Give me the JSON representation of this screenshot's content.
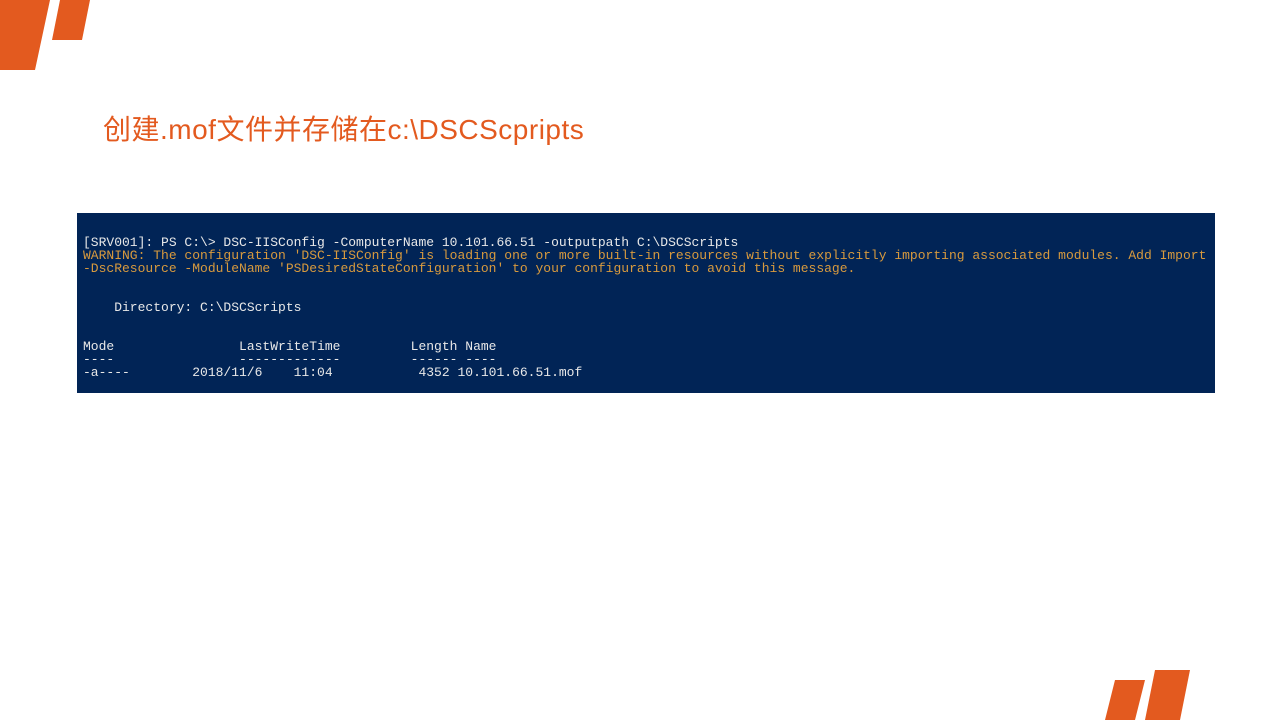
{
  "title": "创建.mof文件并存储在c:\\DSCScpripts",
  "terminal": {
    "prompt": "[SRV001]: PS C:\\> DSC-IISConfig -ComputerName 10.101.66.51 -outputpath C:\\DSCScripts",
    "warning_line1": "WARNING: The configuration 'DSC-IISConfig' is loading one or more built-in resources without explicitly importing associated modules. Add Import",
    "warning_line2": "-DscResource -ModuleName 'PSDesiredStateConfiguration' to your configuration to avoid this message.",
    "blank1": "",
    "blank2": "",
    "directory": "    Directory: C:\\DSCScripts",
    "blank3": "",
    "blank4": "",
    "header": "Mode                LastWriteTime         Length Name",
    "divider": "----                -------------         ------ ----",
    "row1": "-a----        2018/11/6    11:04           4352 10.101.66.51.mof"
  },
  "colors": {
    "accent": "#e35a1f",
    "terminal_bg": "#012456",
    "terminal_text": "#e8e8e8",
    "terminal_warning": "#d89a3e"
  }
}
